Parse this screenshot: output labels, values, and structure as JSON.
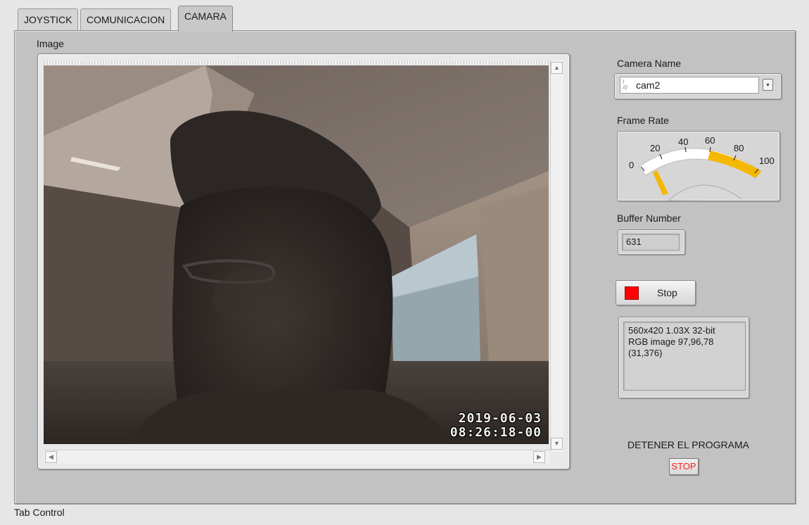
{
  "tabs": [
    {
      "label": "JOYSTICK",
      "active": false
    },
    {
      "label": "COMUNICACION",
      "active": false
    },
    {
      "label": "CAMARA",
      "active": true
    }
  ],
  "image_display": {
    "label": "Image",
    "timestamp_date": "2019-06-03",
    "timestamp_time": "08:26:18-00"
  },
  "camera": {
    "label": "Camera Name",
    "value": "cam2",
    "io_icon": "I/O"
  },
  "frame_rate": {
    "label": "Frame Rate",
    "ticks": [
      "0",
      "20",
      "40",
      "60",
      "80",
      "100"
    ],
    "value": 5,
    "min": 0,
    "max": 100,
    "accent_color": "#f5b800"
  },
  "buffer": {
    "label": "Buffer Number",
    "value": "631"
  },
  "stop_button": {
    "label": "Stop",
    "indicator_color": "#ff0000"
  },
  "image_info": {
    "line1": "560x420 1.03X 32-bit",
    "line2": "RGB image 97,96,78",
    "line3": "(31,376)"
  },
  "detener": {
    "label": "DETENER EL PROGRAMA",
    "button_label": "STOP"
  },
  "tab_control_label": "Tab Control"
}
